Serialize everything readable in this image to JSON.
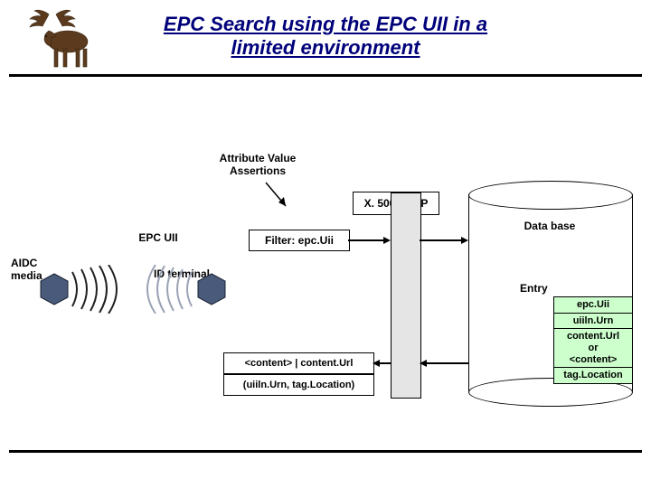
{
  "title_line1": "EPC Search using the EPC UII in a",
  "title_line2": "limited environment",
  "labels": {
    "ava": "Attribute Value\nAssertions",
    "protocol": "X. 500/LDAP",
    "epc_uii": "EPC UII",
    "filter": "Filter: epc.Uii",
    "aidc": "AIDC\nmedia",
    "id_terminal": "ID terminal",
    "content_return": "<content> | content.Url",
    "content_args": "(uiiln.Urn, tag.Location)",
    "database": "Data base",
    "entry_heading": "Entry"
  },
  "entry_rows": {
    "r1": "epc.Uii",
    "r2": "uiiln.Urn",
    "r3": "content.Url\nor\n<content>",
    "r4": "tag.Location"
  }
}
